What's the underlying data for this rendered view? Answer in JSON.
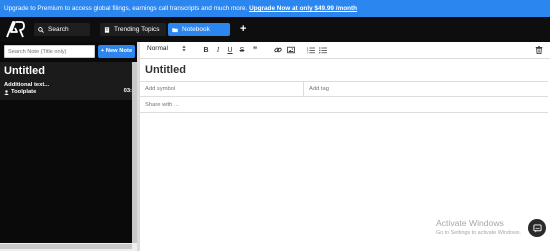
{
  "banner": {
    "text": "Upgrade to Premium to access global filings, earnings call transcripts and much more. ",
    "link": "Upgrade Now at only $49.99 /month"
  },
  "nav": {
    "logo": "AR",
    "tabs": [
      {
        "label": "Search",
        "icon": "search-icon"
      },
      {
        "label": "Trending Topics",
        "icon": "document-icon"
      },
      {
        "label": "Notebook",
        "icon": "folder-icon",
        "active": true
      }
    ],
    "add_label": "+"
  },
  "sidebar": {
    "search_placeholder": "Search Note (Title only)",
    "new_note_label": "+ New Note",
    "notes": [
      {
        "title": "Untitled",
        "excerpt": "Additional text...",
        "author": "Toolplate",
        "time": "03:"
      }
    ]
  },
  "toolbar": {
    "format_value": "Normal",
    "bold": "B",
    "italic": "I",
    "underline": "U",
    "strike": "S",
    "quote": "”"
  },
  "editor": {
    "title": "Untitled",
    "symbol_placeholder": "Add symbol",
    "tag_placeholder": "Add tag",
    "share_placeholder": "Share with ..."
  },
  "watermark": {
    "title": "Activate Windows",
    "subtitle": "Go to Settings to activate Windows."
  },
  "colors": {
    "accent": "#2b86f0",
    "navbar": "#0e0e0e",
    "sidebar": "#0a0a0a"
  }
}
